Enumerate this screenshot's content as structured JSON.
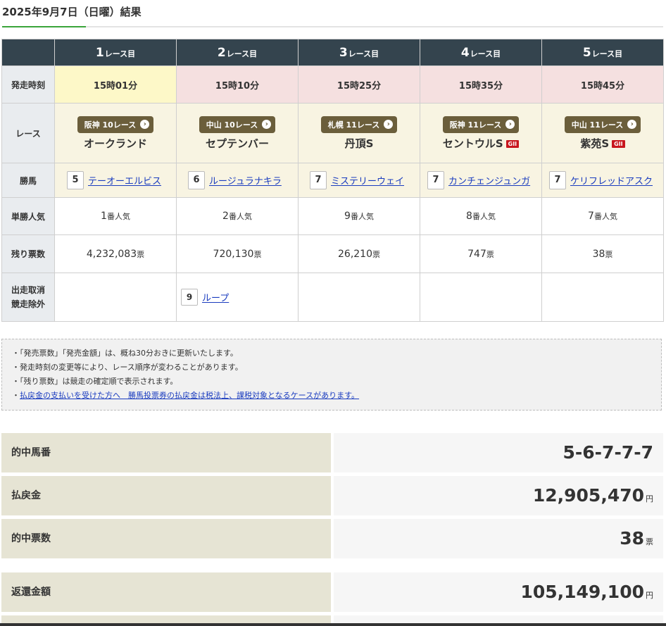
{
  "page": {
    "title": "2025年9月7日（日曜）結果"
  },
  "row_labels": {
    "start_time": "発走時刻",
    "race": "レース",
    "winner": "勝馬",
    "win_popularity": "単勝人気",
    "remaining_votes": "残り票数",
    "scratch_line1": "出走取消",
    "scratch_line2": "競走除外"
  },
  "race_unit": "レース目",
  "races": [
    {
      "num": "1",
      "time": "15時01分",
      "venue": "阪神 10レース",
      "name": "オークランド",
      "grade": "",
      "horse_num": "5",
      "horse": "テーオーエルビス",
      "pop": "1",
      "pop_unit": "番人気",
      "votes": "4,232,083",
      "votes_unit": "票"
    },
    {
      "num": "2",
      "time": "15時10分",
      "venue": "中山 10レース",
      "name": "セプテンバー",
      "grade": "",
      "horse_num": "6",
      "horse": "ルージュラナキラ",
      "pop": "2",
      "pop_unit": "番人気",
      "votes": "720,130",
      "votes_unit": "票"
    },
    {
      "num": "3",
      "time": "15時25分",
      "venue": "札幌 11レース",
      "name": "丹頂S",
      "grade": "",
      "horse_num": "7",
      "horse": "ミステリーウェイ",
      "pop": "9",
      "pop_unit": "番人気",
      "votes": "26,210",
      "votes_unit": "票"
    },
    {
      "num": "4",
      "time": "15時35分",
      "venue": "阪神 11レース",
      "name": "セントウルS",
      "grade": "GII",
      "horse_num": "7",
      "horse": "カンチェンジュンガ",
      "pop": "8",
      "pop_unit": "番人気",
      "votes": "747",
      "votes_unit": "票"
    },
    {
      "num": "5",
      "time": "15時45分",
      "venue": "中山 11レース",
      "name": "紫苑S",
      "grade": "GII",
      "horse_num": "7",
      "horse": "ケリフレッドアスク",
      "pop": "7",
      "pop_unit": "番人気",
      "votes": "38",
      "votes_unit": "票"
    }
  ],
  "scratch": {
    "race_index": 2,
    "num": "9",
    "horse": "ループ"
  },
  "notes": [
    "・「発売票数」「発売金額」は、概ね30分おきに更新いたします。",
    "・発走時刻の変更等により、レース順序が変わることがあります。",
    "・「残り票数」は競走の確定順で表示されます。"
  ],
  "notes_link_prefix": "・",
  "notes_link": "払戻金の支払いを受けた方へ　勝馬投票券の払戻金は税法上、課税対象となるケースがあります。",
  "summary": {
    "hit_numbers_label": "的中馬番",
    "hit_numbers": "5-6-7-7-7",
    "payout_label": "払戻金",
    "payout": "12,905,470",
    "payout_unit": "円",
    "hit_votes_label": "的中票数",
    "hit_votes": "38",
    "hit_votes_unit": "票",
    "refund_label": "返還金額",
    "refund": "105,149,100",
    "refund_unit": "円"
  }
}
